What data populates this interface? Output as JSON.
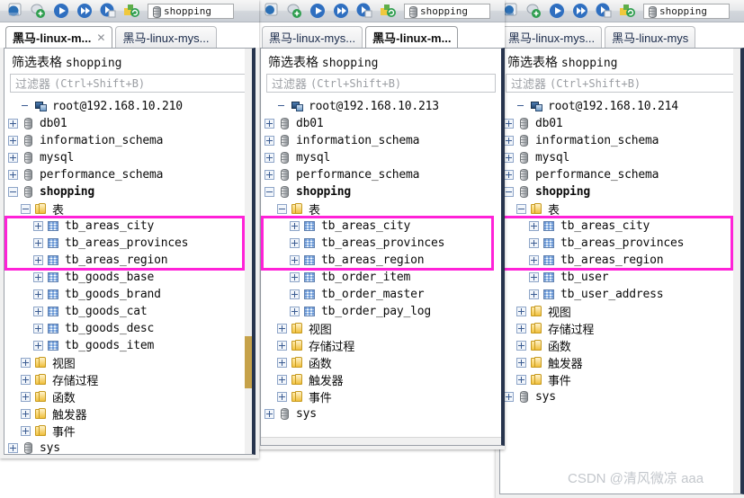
{
  "watermark": "CSDN @清风微凉 aaa",
  "toolbar": {
    "icons": [
      "database-connect-icon",
      "add-connection-icon",
      "run-icon",
      "run-all-icon",
      "stop-icon",
      "refresh-icon"
    ],
    "address_value": "shopping",
    "address_icon": "database-icon"
  },
  "panels": [
    {
      "id": "panel-210",
      "tabs": [
        {
          "label": "黑马-linux-m...",
          "active": true,
          "closable": true
        },
        {
          "label": "黑马-linux-mys...",
          "active": false,
          "closable": false
        }
      ],
      "filter": {
        "title_cjk": "筛选表格",
        "title_value": "shopping",
        "placeholder_cjk": "过滤器",
        "placeholder_key": "(Ctrl+Shift+B)"
      },
      "tree": {
        "host": "root@192.168.10.210",
        "databases": [
          "db01",
          "information_schema",
          "mysql",
          "performance_schema"
        ],
        "selected_db": "shopping",
        "tables_folder": "表",
        "tables": [
          "tb_areas_city",
          "tb_areas_provinces",
          "tb_areas_region",
          "tb_goods_base",
          "tb_goods_brand",
          "tb_goods_cat",
          "tb_goods_desc",
          "tb_goods_item"
        ],
        "highlighted_count": 3,
        "folders": [
          "视图",
          "存储过程",
          "函数",
          "触发器",
          "事件"
        ],
        "trailing_db": "sys"
      }
    },
    {
      "id": "panel-213",
      "tabs": [
        {
          "label": "黑马-linux-mys...",
          "active": false,
          "closable": false
        },
        {
          "label": "黑马-linux-m...",
          "active": true,
          "closable": false
        }
      ],
      "filter": {
        "title_cjk": "筛选表格",
        "title_value": "shopping",
        "placeholder_cjk": "过滤器",
        "placeholder_key": "(Ctrl+Shift+B)"
      },
      "tree": {
        "host": "root@192.168.10.213",
        "databases": [
          "db01",
          "information_schema",
          "mysql",
          "performance_schema"
        ],
        "selected_db": "shopping",
        "tables_folder": "表",
        "tables": [
          "tb_areas_city",
          "tb_areas_provinces",
          "tb_areas_region",
          "tb_order_item",
          "tb_order_master",
          "tb_order_pay_log"
        ],
        "highlighted_count": 3,
        "folders": [
          "视图",
          "存储过程",
          "函数",
          "触发器",
          "事件"
        ],
        "trailing_db": "sys"
      }
    },
    {
      "id": "panel-214",
      "tabs": [
        {
          "label": "黑马-linux-mys...",
          "active": false,
          "closable": false
        },
        {
          "label": "黑马-linux-mys",
          "active": false,
          "closable": false
        }
      ],
      "filter": {
        "title_cjk": "筛选表格",
        "title_value": "shopping",
        "placeholder_cjk": "过滤器",
        "placeholder_key": "(Ctrl+Shift+B)"
      },
      "tree": {
        "host": "root@192.168.10.214",
        "databases": [
          "db01",
          "information_schema",
          "mysql",
          "performance_schema"
        ],
        "selected_db": "shopping",
        "tables_folder": "表",
        "tables": [
          "tb_areas_city",
          "tb_areas_provinces",
          "tb_areas_region",
          "tb_user",
          "tb_user_address"
        ],
        "highlighted_count": 3,
        "folders": [
          "视图",
          "存储过程",
          "函数",
          "触发器",
          "事件"
        ],
        "trailing_db": "sys"
      }
    }
  ],
  "colors": {
    "highlight": "#ff22d8",
    "pane_border": "#27344d",
    "scroll_thumb": "#c6a24a"
  }
}
